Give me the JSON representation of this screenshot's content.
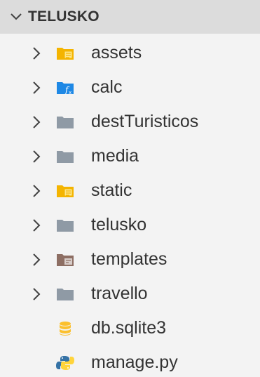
{
  "explorer": {
    "root_label": "TELUSKO",
    "items": [
      {
        "label": "assets",
        "kind": "folder",
        "icon": "folder-assets-icon",
        "expandable": true
      },
      {
        "label": "calc",
        "kind": "folder",
        "icon": "folder-function-icon",
        "expandable": true
      },
      {
        "label": "destTuristicos",
        "kind": "folder",
        "icon": "folder-icon",
        "expandable": true
      },
      {
        "label": "media",
        "kind": "folder",
        "icon": "folder-icon",
        "expandable": true
      },
      {
        "label": "static",
        "kind": "folder",
        "icon": "folder-assets-icon",
        "expandable": true
      },
      {
        "label": "telusko",
        "kind": "folder",
        "icon": "folder-icon",
        "expandable": true
      },
      {
        "label": "templates",
        "kind": "folder",
        "icon": "folder-templates-icon",
        "expandable": true
      },
      {
        "label": "travello",
        "kind": "folder",
        "icon": "folder-icon",
        "expandable": true
      },
      {
        "label": "db.sqlite3",
        "kind": "file",
        "icon": "database-icon",
        "expandable": false
      },
      {
        "label": "manage.py",
        "kind": "file",
        "icon": "python-icon",
        "expandable": false
      }
    ]
  },
  "colors": {
    "background": "#f3f3f3",
    "header_background": "#dcdcdc",
    "folder_gray": "#8f9aa5",
    "folder_yellow": "#f4b400",
    "folder_blue": "#1e88e5",
    "folder_brown": "#8d6e63",
    "python_blue": "#3572a5",
    "python_yellow": "#ffd43b"
  }
}
